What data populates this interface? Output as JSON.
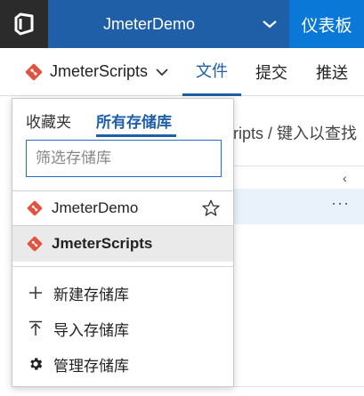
{
  "topbar": {
    "project_name": "JmeterDemo",
    "dashboard_label": "仪表板"
  },
  "subnav": {
    "current_repo": "JmeterScripts",
    "tabs": [
      {
        "label": "文件",
        "active": true
      },
      {
        "label": "提交",
        "active": false
      },
      {
        "label": "推送",
        "active": false
      }
    ]
  },
  "background": {
    "breadcrumb_text": "ripts  /  键入以查找",
    "more_label": "···",
    "collapse_label": "‹"
  },
  "repo_panel": {
    "tab_favorites": "收藏夹",
    "tab_all": "所有存储库",
    "filter_placeholder": "筛选存储库",
    "repos": [
      {
        "name": "JmeterDemo",
        "selected": false,
        "starred": false
      },
      {
        "name": "JmeterScripts",
        "selected": true
      }
    ],
    "actions": {
      "new": "新建存储库",
      "import": "导入存储库",
      "manage": "管理存储库"
    }
  },
  "colors": {
    "topbar_blue": "#1f5fa8",
    "dashboard_blue": "#0a78d7",
    "git_orange": "#e2533f",
    "accent": "#1f5fa8"
  }
}
